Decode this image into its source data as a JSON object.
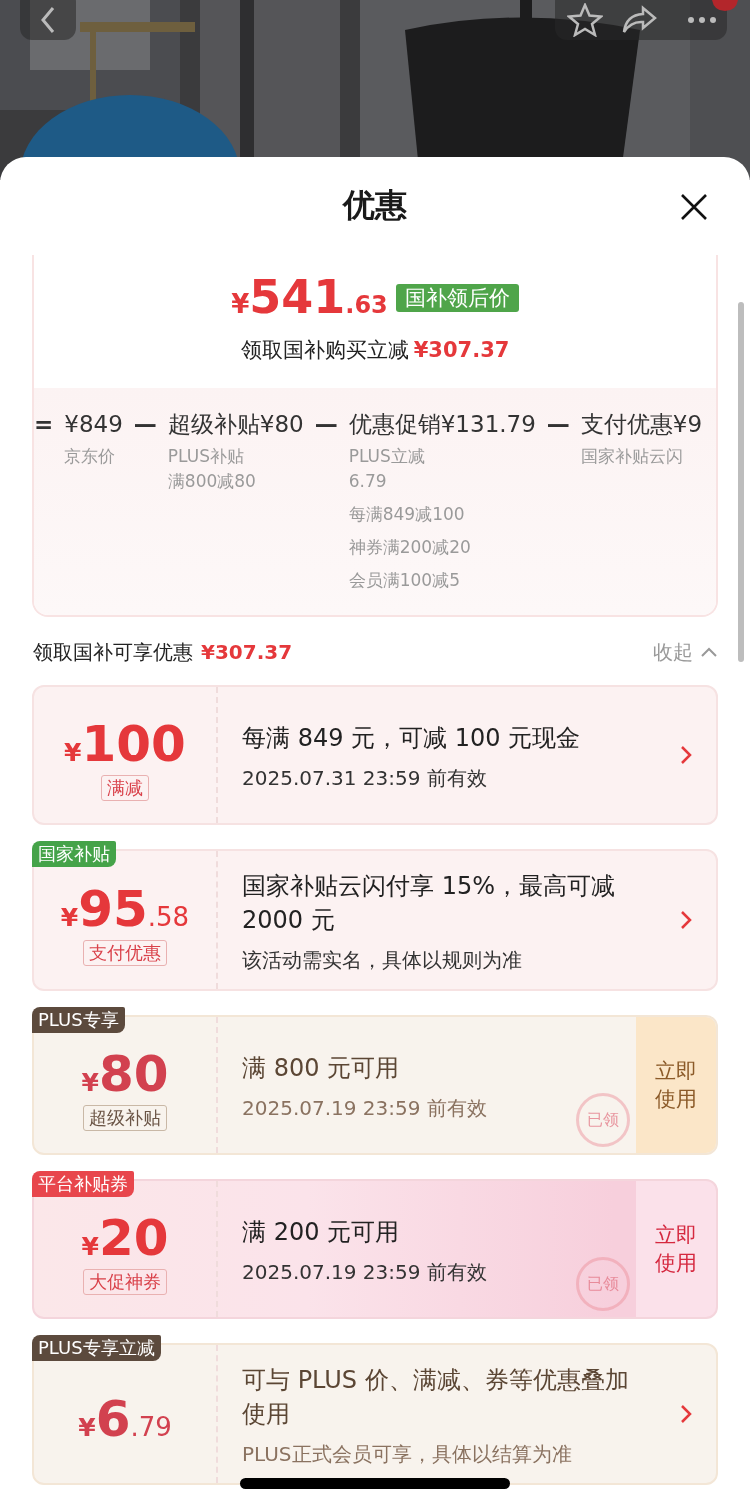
{
  "sheet": {
    "title": "优惠"
  },
  "summary": {
    "currency": "¥",
    "price_int": "541",
    "price_dec": ".63",
    "price_badge": "国补领后价",
    "saving_label": "领取国补购买立减",
    "saving_amount": "¥307.37"
  },
  "breakdown": [
    {
      "operator": "=",
      "title": "¥849",
      "details": [
        "京东价"
      ]
    },
    {
      "operator": "—",
      "title": "超级补贴¥80",
      "details": [
        "PLUS补贴",
        "满800减80"
      ]
    },
    {
      "operator": "—",
      "title": "优惠促销¥131.79",
      "details": [
        "PLUS立减",
        "6.79",
        "每满849减100",
        "神券满200减20",
        "会员满100减5"
      ]
    },
    {
      "operator": "—",
      "title": "支付优惠¥9",
      "details": [
        "国家补贴云闪"
      ]
    }
  ],
  "section": {
    "title": "领取国补可享优惠",
    "amount": "¥307.37",
    "toggle": "收起",
    "expanded": true
  },
  "coupons": [
    {
      "kind": "plain",
      "currency": "¥",
      "amount_int": "100",
      "label": "满减",
      "title": "每满 849 元，可减 100 元现金",
      "subtitle": "2025.07.31 23:59 前有效"
    },
    {
      "kind": "plain",
      "tag": {
        "text": "国家补贴",
        "color": "#45a349"
      },
      "currency": "¥",
      "amount_int": "95",
      "amount_dec": ".58",
      "label": "支付优惠",
      "title": "国家补贴云闪付享 15%，最高可减 2000 元",
      "subtitle": "该活动需实名，具体以规则为准"
    },
    {
      "kind": "plus",
      "tag": {
        "text": "PLUS专享",
        "color": "#5c4a3d"
      },
      "currency": "¥",
      "amount_int": "80",
      "label": "超级补贴",
      "title": "满 800 元可用",
      "subtitle": "2025.07.19 23:59 前有效",
      "action": "立即使用",
      "stamp": "已领"
    },
    {
      "kind": "pink",
      "tag": {
        "text": "平台补贴券",
        "color": "#e8464c"
      },
      "currency": "¥",
      "amount_int": "20",
      "label": "大促神券",
      "title": "满 200 元可用",
      "subtitle": "2025.07.19 23:59 前有效",
      "action": "立即使用",
      "stamp": "已领"
    },
    {
      "kind": "plus",
      "tag": {
        "text": "PLUS专享立减",
        "color": "#5c4a3d"
      },
      "currency": "¥",
      "amount_int": "6",
      "amount_dec": ".79",
      "title": "可与 PLUS 价、满减、券等优惠叠加使用",
      "subtitle": "PLUS正式会员可享，具体以结算为准"
    }
  ]
}
